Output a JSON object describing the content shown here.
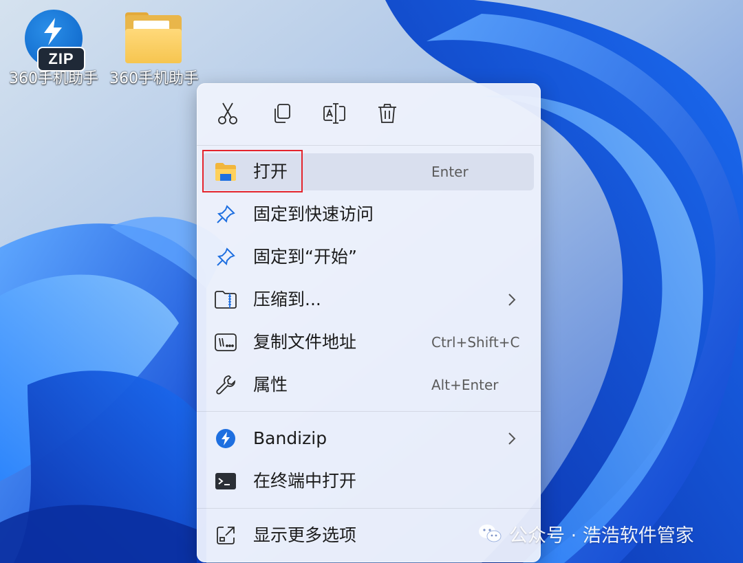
{
  "desktop": {
    "icons": [
      {
        "label": "360手机助手",
        "icon": "bandizip-zip-icon",
        "badge": "ZIP"
      },
      {
        "label": "360手机助手",
        "icon": "folder-icon"
      }
    ]
  },
  "context_menu": {
    "toolbar": [
      {
        "name": "cut",
        "icon": "scissors-icon"
      },
      {
        "name": "copy",
        "icon": "copy-icon"
      },
      {
        "name": "rename",
        "icon": "rename-icon"
      },
      {
        "name": "delete",
        "icon": "trash-icon"
      }
    ],
    "items": [
      {
        "label": "打开",
        "shortcut": "Enter",
        "icon": "folder-open-icon",
        "highlighted": true
      },
      {
        "label": "固定到快速访问",
        "icon": "pin-icon"
      },
      {
        "label": "固定到“开始”",
        "icon": "pin-icon"
      },
      {
        "label": "压缩到...",
        "icon": "zip-folder-icon",
        "submenu": true
      },
      {
        "label": "复制文件地址",
        "shortcut": "Ctrl+Shift+C",
        "icon": "path-copy-icon"
      },
      {
        "label": "属性",
        "shortcut": "Alt+Enter",
        "icon": "wrench-icon"
      },
      {
        "label": "Bandizip",
        "icon": "bandizip-icon",
        "submenu": true
      },
      {
        "label": "在终端中打开",
        "icon": "terminal-icon"
      },
      {
        "label": "显示更多选项",
        "icon": "expand-icon"
      }
    ]
  },
  "watermark": {
    "text": "公众号 · 浩浩软件管家"
  },
  "colors": {
    "accent_blue": "#1e6fe0",
    "highlight_box": "#e4242c",
    "menu_bg": "#eff2fc"
  }
}
